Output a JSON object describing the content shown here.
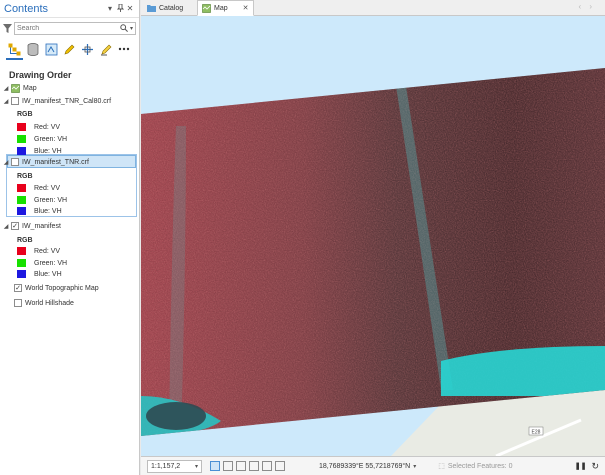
{
  "contents": {
    "title": "Contents",
    "search_placeholder": "Search",
    "drawing_order_title": "Drawing Order",
    "layers": {
      "map": "Map",
      "cal80": {
        "name": "IW_manifest_TNR_Cal80.crf",
        "rgb_label": "RGB",
        "bands": [
          {
            "label": "Red:  VV",
            "color": "#e8001c"
          },
          {
            "label": "Green: VH",
            "color": "#17e000"
          },
          {
            "label": "Blue: VH",
            "color": "#1d18e0"
          }
        ]
      },
      "tnr": {
        "name": "IW_manifest_TNR.crf",
        "rgb_label": "RGB",
        "bands": [
          {
            "label": "Red:  VV",
            "color": "#e8001c"
          },
          {
            "label": "Green: VH",
            "color": "#17e000"
          },
          {
            "label": "Blue: VH",
            "color": "#1d18e0"
          }
        ]
      },
      "manifest": {
        "name": "IW_manifest",
        "rgb_label": "RGB",
        "bands": [
          {
            "label": "Red:  VV",
            "color": "#e8001c"
          },
          {
            "label": "Green: VH",
            "color": "#17e000"
          },
          {
            "label": "Blue: VH",
            "color": "#1d18e0"
          }
        ]
      },
      "topo": "World Topographic Map",
      "hillshade": "World Hillshade"
    },
    "accent_color": "#2a6ebb"
  },
  "tabs": [
    {
      "label": "Catalog",
      "icon": "catalog-icon"
    },
    {
      "label": "Map",
      "icon": "map-icon",
      "active": true
    }
  ],
  "map": {
    "road_label": "E28",
    "water_color": "#cde9fb"
  },
  "status": {
    "scale": "1:1,157,2",
    "coordinates": "18,7689339°E 55,7218769°N",
    "selected_features": "Selected Features: 0"
  }
}
